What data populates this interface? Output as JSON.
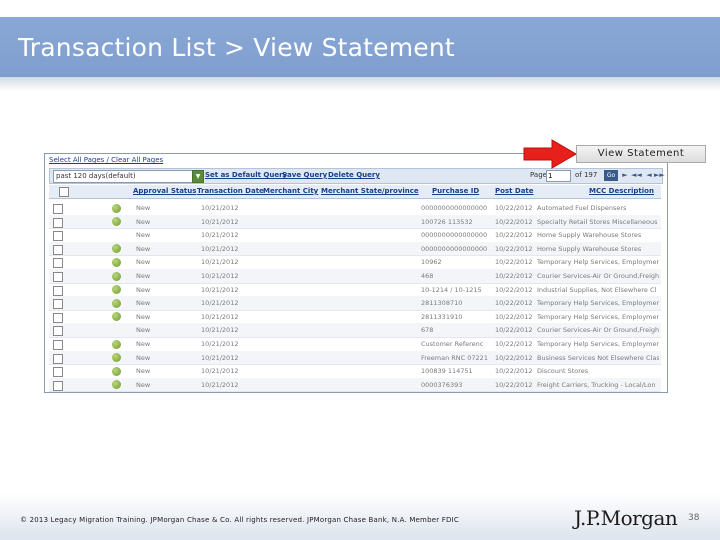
{
  "slide": {
    "title": "Transaction List > View Statement",
    "view_statement_label": "View Statement",
    "footer_copyright": "© 2013 Legacy Migration Training. JPMorgan Chase & Co. All rights reserved. JPMorgan Chase Bank, N.A. Member FDIC",
    "logo_text": "J.P.Morgan",
    "page_number": "38"
  },
  "app": {
    "select_links": "Select All Pages / Clear All Pages",
    "query_value": "past 120 days(default)",
    "toolbar_links": [
      "Set as Default Query",
      "Save Query",
      "Delete Query"
    ],
    "page_label": "Page",
    "page_value": "1",
    "page_of": "of 197",
    "go_label": "Go",
    "columns": [
      "Approval Status",
      "Transaction Date",
      "Merchant City",
      "Merchant State/province",
      "Purchase ID",
      "Post Date",
      "MCC Description"
    ],
    "rows": [
      {
        "status_icon": true,
        "approval": "New",
        "tdate": "10/21/2012",
        "pid": "0000000000000000",
        "post": "10/22/2012",
        "mcc": "Automated Fuel Dispensers"
      },
      {
        "status_icon": true,
        "approval": "New",
        "tdate": "10/21/2012",
        "pid": "100726 113532",
        "post": "10/22/2012",
        "mcc": "Specialty Retail Stores Miscellaneous"
      },
      {
        "status_icon": false,
        "approval": "New",
        "tdate": "10/21/2012",
        "pid": "0000000000000000",
        "post": "10/22/2012",
        "mcc": "Home Supply Warehouse Stores"
      },
      {
        "status_icon": true,
        "approval": "New",
        "tdate": "10/21/2012",
        "pid": "0000000000000000",
        "post": "10/22/2012",
        "mcc": "Home Supply Warehouse Stores"
      },
      {
        "status_icon": true,
        "approval": "New",
        "tdate": "10/21/2012",
        "pid": "10962",
        "post": "10/22/2012",
        "mcc": "Temporary Help Services, Employment"
      },
      {
        "status_icon": true,
        "approval": "New",
        "tdate": "10/21/2012",
        "pid": "468",
        "post": "10/22/2012",
        "mcc": "Courier Services-Air Or Ground,Freight"
      },
      {
        "status_icon": true,
        "approval": "New",
        "tdate": "10/21/2012",
        "pid": "10-1214 / 10-1215",
        "post": "10/22/2012",
        "mcc": "Industrial Supplies, Not Elsewhere Cl"
      },
      {
        "status_icon": true,
        "approval": "New",
        "tdate": "10/21/2012",
        "pid": "2811308710",
        "post": "10/22/2012",
        "mcc": "Temporary Help Services, Employment"
      },
      {
        "status_icon": true,
        "approval": "New",
        "tdate": "10/21/2012",
        "pid": "2811331910",
        "post": "10/22/2012",
        "mcc": "Temporary Help Services, Employment"
      },
      {
        "status_icon": false,
        "approval": "New",
        "tdate": "10/21/2012",
        "pid": "678",
        "post": "10/22/2012",
        "mcc": "Courier Services-Air Or Ground,Freight"
      },
      {
        "status_icon": true,
        "approval": "New",
        "tdate": "10/21/2012",
        "pid": "Customer Referenc",
        "post": "10/22/2012",
        "mcc": "Temporary Help Services, Employment"
      },
      {
        "status_icon": true,
        "approval": "New",
        "tdate": "10/21/2012",
        "pid": "Freeman RNC 07221",
        "post": "10/22/2012",
        "mcc": "Business Services Not Elsewhere Clas"
      },
      {
        "status_icon": true,
        "approval": "New",
        "tdate": "10/21/2012",
        "pid": "100839 114751",
        "post": "10/22/2012",
        "mcc": "Discount Stores"
      },
      {
        "status_icon": true,
        "approval": "New",
        "tdate": "10/21/2012",
        "pid": "0000376393",
        "post": "10/22/2012",
        "mcc": "Freight Carriers, Trucking - Local/Lon"
      }
    ]
  },
  "colors": {
    "title_bar": "#7f9ed0",
    "accent_arrow": "#e8201c",
    "link": "#1a3f8a"
  }
}
